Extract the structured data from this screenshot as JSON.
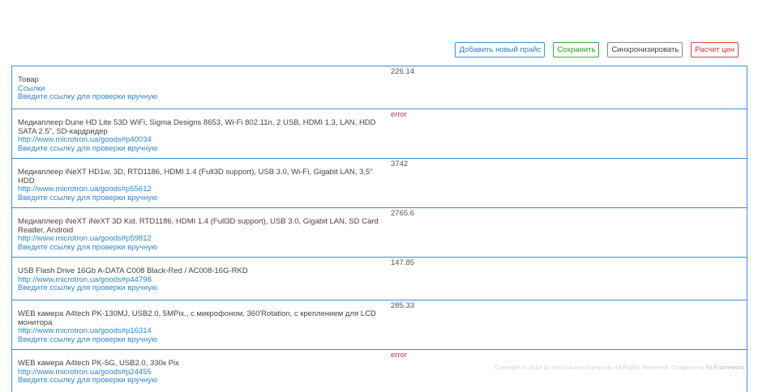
{
  "toolbar": {
    "add_label": "Добавить новый прайс",
    "save_label": "Сохранить",
    "sync_label": "Синхронизировать",
    "calc_label": "Расчет цен"
  },
  "rows": [
    {
      "name": "Товар",
      "link": "Ссылки",
      "manual": "Введите ссылку для проверки вручную",
      "price": "226.14"
    },
    {
      "name": "Медиаплеер Dune HD Lite 53D WiFi, Sigma Designs 8653, Wi-Fi 802.11n, 2 USB, HDMI 1.3, LAN, HDD SATA 2.5\", SD-кардридер",
      "link": "http://www.microtron.ua/goods#p40034",
      "manual": "Введите ссылку для проверки вручную",
      "price": "error"
    },
    {
      "name": "Медиаплеер iNeXT HD1w, 3D, RTD1186, HDMI 1.4 (Full3D support), USB 3.0, Wi-Fi, Gigabit LAN, 3,5\" HDD",
      "link": "http://www.microtron.ua/goods#p55612",
      "manual": "Введите ссылку для проверки вручную",
      "price": "3742"
    },
    {
      "name": "Медиаплеер iNeXT iNeXT 3D Kid, RTD1186, HDMI 1.4 (Full3D support), USB 3.0, Gigabit LAN, SD Card Reader, Android",
      "link": "http://www.microtron.ua/goods#p59812",
      "manual": "Введите ссылку для проверки вручную",
      "price": "2765.6"
    },
    {
      "name": "USB Flash Drive 16Gb A-DATA C008 Black-Red / AC008-16G-RKD",
      "link": "http://www.microtron.ua/goods#p44798",
      "manual": "Введите ссылку для проверки вручную",
      "price": "147.85"
    },
    {
      "name": "WEB камера A4tech PK-130MJ, USB2.0, 5MPix., с микрофоном, 360'Rotation, с креплением для LCD монитора",
      "link": "http://www.microtron.ua/goods#p16314",
      "manual": "Введите ссылку для проверки вручную",
      "price": "285.33"
    },
    {
      "name": "WEB камера A4tech PK-5G, USB2.0, 330к Pix",
      "link": "http://www.microtron.ua/goods#p24455",
      "manual": "Введите ссылку для проверки вручную",
      "price": "error"
    }
  ],
  "footer": {
    "copyright": "Copyright © 2014 by Intext Auran Company. All Rights Reserved. Создано на",
    "framework": "Yii Framework."
  }
}
